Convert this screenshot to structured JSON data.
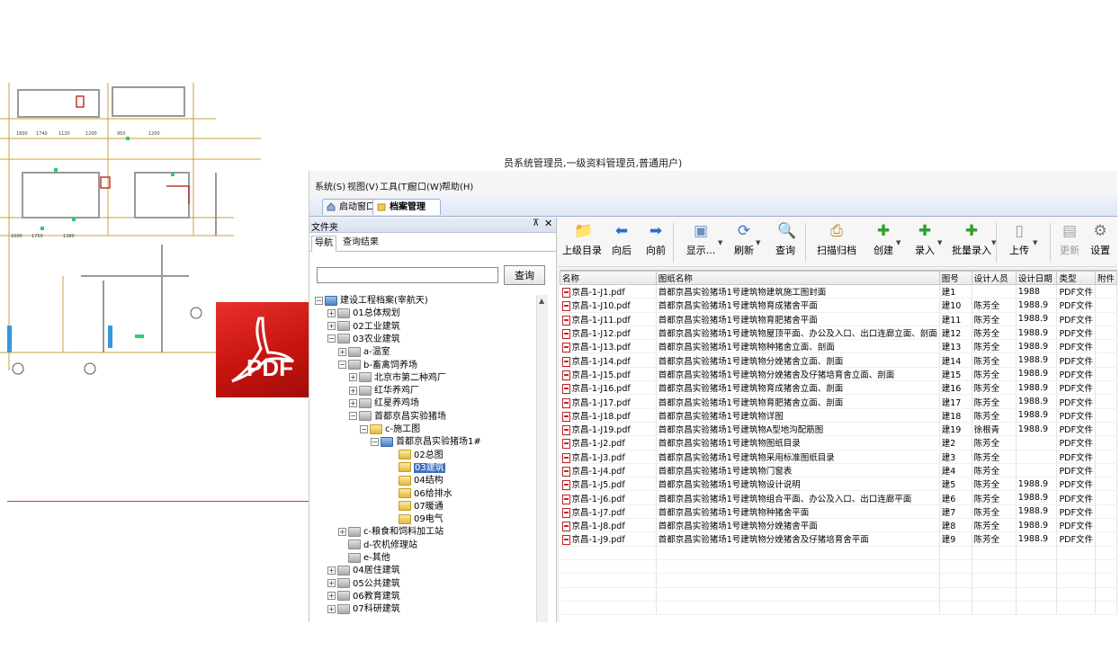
{
  "window": {
    "title": "员系统管理员,一级资料管理员,普通用户)"
  },
  "pdf_logo": {
    "text": "PDF",
    "color": "#d1201b"
  },
  "menu": [
    "系统(S)",
    "视图(V)",
    "工具(T)",
    "窗口(W)",
    "帮助(H)"
  ],
  "doc_tabs": [
    {
      "label": "启动窗口",
      "active": false
    },
    {
      "label": "档案管理",
      "active": true
    }
  ],
  "dock": {
    "title": "文件夹",
    "pin_icon": "pin-icon",
    "close_glyph": "✕",
    "tabs": [
      "导航",
      "查询结果"
    ],
    "search_placeholder": "",
    "search_button": "查询"
  },
  "tree": [
    {
      "label": "建设工程档案(宰航天)",
      "level": 0,
      "exp": "-",
      "icon": "db"
    },
    {
      "label": "01总体规划",
      "level": 1,
      "exp": "+",
      "icon": "grey"
    },
    {
      "label": "02工业建筑",
      "level": 1,
      "exp": "+",
      "icon": "grey"
    },
    {
      "label": "03农业建筑",
      "level": 1,
      "exp": "-",
      "icon": "grey"
    },
    {
      "label": "a-温室",
      "level": 2,
      "exp": "+",
      "icon": "grey"
    },
    {
      "label": "b-畜禽饲养场",
      "level": 2,
      "exp": "-",
      "icon": "grey"
    },
    {
      "label": "北京市第二种鸡厂",
      "level": 3,
      "exp": "+",
      "icon": "grey"
    },
    {
      "label": "红华养鸡厂",
      "level": 3,
      "exp": "+",
      "icon": "grey"
    },
    {
      "label": "红星养鸡场",
      "level": 3,
      "exp": "+",
      "icon": "grey"
    },
    {
      "label": "首都京昌实验猪场",
      "level": 3,
      "exp": "-",
      "icon": "grey"
    },
    {
      "label": "c-施工图",
      "level": 4,
      "exp": "-",
      "icon": "yellow"
    },
    {
      "label": "首都京昌实验猪场1#",
      "level": 5,
      "exp": "-",
      "icon": "db"
    },
    {
      "label": "02总图",
      "level": 6,
      "exp": "",
      "icon": "yellow"
    },
    {
      "label": "03建筑",
      "level": 6,
      "exp": "",
      "icon": "yellow",
      "selected": true
    },
    {
      "label": "04结构",
      "level": 6,
      "exp": "",
      "icon": "yellow"
    },
    {
      "label": "06给排水",
      "level": 6,
      "exp": "",
      "icon": "yellow"
    },
    {
      "label": "07暖通",
      "level": 6,
      "exp": "",
      "icon": "yellow"
    },
    {
      "label": "09电气",
      "level": 6,
      "exp": "",
      "icon": "yellow"
    },
    {
      "label": "c-粮食和饲料加工站",
      "level": 2,
      "exp": "+",
      "icon": "grey"
    },
    {
      "label": "d-农机修理站",
      "level": 2,
      "exp": "",
      "icon": "grey"
    },
    {
      "label": "e-其他",
      "level": 2,
      "exp": "",
      "icon": "grey"
    },
    {
      "label": "04居住建筑",
      "level": 1,
      "exp": "+",
      "icon": "grey"
    },
    {
      "label": "05公共建筑",
      "level": 1,
      "exp": "+",
      "icon": "grey"
    },
    {
      "label": "06教育建筑",
      "level": 1,
      "exp": "+",
      "icon": "grey"
    },
    {
      "label": "07科研建筑",
      "level": 1,
      "exp": "+",
      "icon": "grey"
    }
  ],
  "toolbar": [
    {
      "label": "上级目录",
      "icon": "folder-up-icon",
      "glyph": "📁",
      "color": "#e0a020",
      "dropdown": false
    },
    {
      "label": "向后",
      "icon": "back-arrow-icon",
      "glyph": "⬅",
      "color": "#2a6fd0",
      "dropdown": false
    },
    {
      "label": "向前",
      "icon": "forward-arrow-icon",
      "glyph": "➡",
      "color": "#2a6fd0",
      "dropdown": false
    },
    {
      "label": "显示...",
      "icon": "display-icon",
      "glyph": "▣",
      "color": "#6b8fc0",
      "dropdown": true
    },
    {
      "label": "刷新",
      "icon": "refresh-icon",
      "glyph": "⟳",
      "color": "#3a7ad0",
      "dropdown": true
    },
    {
      "label": "查询",
      "icon": "search-icon",
      "glyph": "🔍",
      "color": "#888888",
      "dropdown": false
    },
    {
      "label": "扫描归档",
      "icon": "scan-icon",
      "glyph": "⎙",
      "color": "#c08a20",
      "dropdown": false
    },
    {
      "label": "创建",
      "icon": "create-icon",
      "glyph": "✚",
      "color": "#2ea02e",
      "dropdown": true
    },
    {
      "label": "录入",
      "icon": "input-icon",
      "glyph": "✚",
      "color": "#2ea02e",
      "dropdown": true
    },
    {
      "label": "批量录入",
      "icon": "batch-input-icon",
      "glyph": "✚",
      "color": "#2ea02e",
      "dropdown": true
    },
    {
      "label": "上传",
      "icon": "upload-icon",
      "glyph": "▯",
      "color": "#9a9a9a",
      "dropdown": true
    },
    {
      "label": "更新",
      "icon": "update-icon",
      "glyph": "▤",
      "color": "#a0a0a0",
      "dropdown": false,
      "disabled": true
    },
    {
      "label": "设置",
      "icon": "settings-icon",
      "glyph": "⚙",
      "color": "#7a7a7a",
      "dropdown": false
    }
  ],
  "grid": {
    "columns": [
      "名称",
      "图纸名称",
      "图号",
      "设计人员",
      "设计日期",
      "类型",
      "附件"
    ],
    "rows": [
      [
        "京昌-1-J1.pdf",
        "首都京昌实验猪场1号建筑物建筑施工图封面",
        "建1",
        "",
        "1988",
        "PDF文件",
        ""
      ],
      [
        "京昌-1-J10.pdf",
        "首都京昌实验猪场1号建筑物育成猪舍平面",
        "建10",
        "陈芳全",
        "1988.9",
        "PDF文件",
        ""
      ],
      [
        "京昌-1-J11.pdf",
        "首都京昌实验猪场1号建筑物育肥猪舍平面",
        "建11",
        "陈芳全",
        "1988.9",
        "PDF文件",
        ""
      ],
      [
        "京昌-1-J12.pdf",
        "首都京昌实验猪场1号建筑物屋顶平面、办公及入口、出口连廊立面、剖面",
        "建12",
        "陈芳全",
        "1988.9",
        "PDF文件",
        ""
      ],
      [
        "京昌-1-J13.pdf",
        "首都京昌实验猪场1号建筑物种猪舍立面、剖面",
        "建13",
        "陈芳全",
        "1988.9",
        "PDF文件",
        ""
      ],
      [
        "京昌-1-J14.pdf",
        "首都京昌实验猪场1号建筑物分娩猪舍立面、剖面",
        "建14",
        "陈芳全",
        "1988.9",
        "PDF文件",
        ""
      ],
      [
        "京昌-1-J15.pdf",
        "首都京昌实验猪场1号建筑物分娩猪舍及仔猪培育舍立面、剖面",
        "建15",
        "陈芳全",
        "1988.9",
        "PDF文件",
        ""
      ],
      [
        "京昌-1-J16.pdf",
        "首都京昌实验猪场1号建筑物育成猪舍立面、剖面",
        "建16",
        "陈芳全",
        "1988.9",
        "PDF文件",
        ""
      ],
      [
        "京昌-1-J17.pdf",
        "首都京昌实验猪场1号建筑物育肥猪舍立面、剖面",
        "建17",
        "陈芳全",
        "1988.9",
        "PDF文件",
        ""
      ],
      [
        "京昌-1-J18.pdf",
        "首都京昌实验猪场1号建筑物详图",
        "建18",
        "陈芳全",
        "1988.9",
        "PDF文件",
        ""
      ],
      [
        "京昌-1-J19.pdf",
        "首都京昌实验猪场1号建筑物A型地沟配筋图",
        "建19",
        "徐根青",
        "1988.9",
        "PDF文件",
        ""
      ],
      [
        "京昌-1-J2.pdf",
        "首都京昌实验猪场1号建筑物图纸目录",
        "建2",
        "陈芳全",
        "",
        "PDF文件",
        ""
      ],
      [
        "京昌-1-J3.pdf",
        "首都京昌实验猪场1号建筑物采用标准图纸目录",
        "建3",
        "陈芳全",
        "",
        "PDF文件",
        ""
      ],
      [
        "京昌-1-J4.pdf",
        "首都京昌实验猪场1号建筑物门窗表",
        "建4",
        "陈芳全",
        "",
        "PDF文件",
        ""
      ],
      [
        "京昌-1-J5.pdf",
        "首都京昌实验猪场1号建筑物设计说明",
        "建5",
        "陈芳全",
        "1988.9",
        "PDF文件",
        ""
      ],
      [
        "京昌-1-J6.pdf",
        "首都京昌实验猪场1号建筑物组合平面、办公及入口、出口连廊平面",
        "建6",
        "陈芳全",
        "1988.9",
        "PDF文件",
        ""
      ],
      [
        "京昌-1-J7.pdf",
        "首都京昌实验猪场1号建筑物种猪舍平面",
        "建7",
        "陈芳全",
        "1988.9",
        "PDF文件",
        ""
      ],
      [
        "京昌-1-J8.pdf",
        "首都京昌实验猪场1号建筑物分娩猪舍平面",
        "建8",
        "陈芳全",
        "1988.9",
        "PDF文件",
        ""
      ],
      [
        "京昌-1-J9.pdf",
        "首都京昌实验猪场1号建筑物分娩猪舍及仔猪培育舍平面",
        "建9",
        "陈芳全",
        "1988.9",
        "PDF文件",
        ""
      ]
    ],
    "empty_rows": 5
  }
}
